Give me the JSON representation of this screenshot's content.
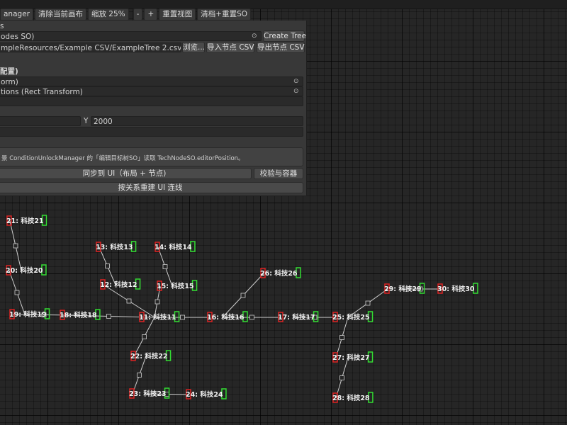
{
  "toolbar": {
    "items": [
      "anager",
      "清除当前画布",
      "缩放 25%",
      "-",
      "+",
      "重置视图",
      "清档+重置SO"
    ]
  },
  "inspector": {
    "row1_label": "s",
    "row2_value": "odes SO)",
    "create_tree": "Create Tree",
    "csv_path": "mpleResources/Example CSV/ExampleTree 2.csv",
    "browse": "浏览...",
    "import_csv": "导入节点 CSV",
    "export_csv": "导出节点 CSV",
    "section_header": "配置)",
    "field_a": "orm)",
    "field_b": "tions (Rect Transform)",
    "y_label": "Y",
    "y_value": "2000",
    "help_text": "景 ConditionUnlockManager 的「编辑目标树SO」读取 TechNodeSO.editorPosition。",
    "sync_ui": "同步到 UI（布局 + 节点)",
    "validate": "校验与容器",
    "rebuild_lines": "按关系重建 UI 连线"
  },
  "graph": {
    "colors": {
      "edge": "#cfcfcf",
      "red_port": "#dd2222",
      "green_port": "#33dd33",
      "label": "#f2f2f2"
    },
    "nodes": [
      {
        "id": 11,
        "label": "11: 科技11"
      },
      {
        "id": 12,
        "label": "12: 科技12"
      },
      {
        "id": 13,
        "label": "13: 科技13"
      },
      {
        "id": 14,
        "label": "14: 科技14"
      },
      {
        "id": 15,
        "label": "15: 科技15"
      },
      {
        "id": 16,
        "label": "16: 科技16"
      },
      {
        "id": 17,
        "label": "17: 科技17"
      },
      {
        "id": 18,
        "label": "18: 科技18"
      },
      {
        "id": 19,
        "label": "19: 科技19"
      },
      {
        "id": 20,
        "label": "20: 科技20"
      },
      {
        "id": 21,
        "label": "21: 科技21"
      },
      {
        "id": 22,
        "label": "22: 科技22"
      },
      {
        "id": 23,
        "label": "23: 科技23"
      },
      {
        "id": 24,
        "label": "24: 科技24"
      },
      {
        "id": 25,
        "label": "25: 科技25"
      },
      {
        "id": 26,
        "label": "26: 科技26"
      },
      {
        "id": 27,
        "label": "27: 科技27"
      },
      {
        "id": 28,
        "label": "28: 科技28"
      },
      {
        "id": 29,
        "label": "29: 科技29"
      },
      {
        "id": 30,
        "label": "30: 科技30"
      }
    ],
    "edges": [
      [
        11,
        12
      ],
      [
        11,
        15
      ],
      [
        11,
        16
      ],
      [
        11,
        18
      ],
      [
        11,
        22
      ],
      [
        12,
        13
      ],
      [
        15,
        14
      ],
      [
        16,
        17
      ],
      [
        16,
        26
      ],
      [
        17,
        25
      ],
      [
        18,
        19
      ],
      [
        19,
        20
      ],
      [
        20,
        21
      ],
      [
        22,
        23
      ],
      [
        23,
        24
      ],
      [
        25,
        27
      ],
      [
        25,
        29
      ],
      [
        27,
        28
      ],
      [
        29,
        30
      ]
    ]
  }
}
